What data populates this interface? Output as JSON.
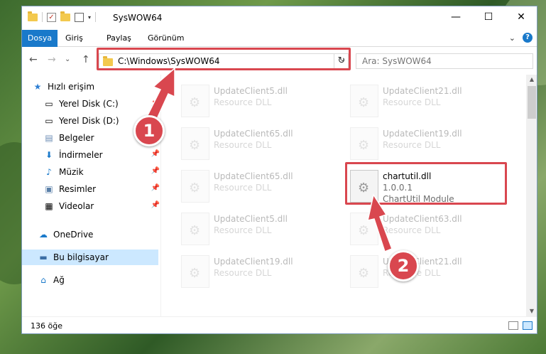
{
  "window": {
    "title": "SysWOW64",
    "controls": {
      "minimize": "—",
      "maximize": "☐",
      "close": "✕"
    }
  },
  "ribbon": {
    "tabs": [
      "Dosya",
      "Giriş",
      "Paylaş",
      "Görünüm"
    ],
    "help": "?"
  },
  "nav": {
    "back": "←",
    "forward": "→",
    "recent": "⌄",
    "up": "↑",
    "address": "C:\\Windows\\SysWOW64",
    "refresh": "↻",
    "search_placeholder": "Ara: SysWOW64"
  },
  "sidebar": {
    "items": [
      {
        "label": "Hızlı erişim",
        "icon": "star-icon"
      },
      {
        "label": "Yerel Disk (C:)",
        "icon": "drive-icon"
      },
      {
        "label": "Yerel Disk (D:)",
        "icon": "drive-icon"
      },
      {
        "label": "Belgeler",
        "icon": "documents-icon"
      },
      {
        "label": "İndirmeler",
        "icon": "download-icon"
      },
      {
        "label": "Müzik",
        "icon": "music-icon"
      },
      {
        "label": "Resimler",
        "icon": "pictures-icon"
      },
      {
        "label": "Videolar",
        "icon": "video-icon"
      },
      {
        "label": "OneDrive",
        "icon": "cloud-icon"
      },
      {
        "label": "Bu bilgisayar",
        "icon": "computer-icon"
      },
      {
        "label": "Ağ",
        "icon": "network-icon"
      }
    ]
  },
  "files": [
    {
      "name": "UpdateClient5.dll",
      "desc": "Resource DLL"
    },
    {
      "name": "UpdateClient21.dll",
      "desc": "Resource DLL"
    },
    {
      "name": "UpdateClient65.dll",
      "desc": "Resource DLL"
    },
    {
      "name": "UpdateClient19.dll",
      "desc": "Resource DLL"
    },
    {
      "name": "UpdateClient65.dll",
      "desc": "Resource DLL"
    },
    {
      "name": "chartutil.dll",
      "desc": "1.0.0.1",
      "desc2": "ChartUtil Module"
    },
    {
      "name": "UpdateClient5.dll",
      "desc": "Resource DLL"
    },
    {
      "name": "UpdateClient63.dll",
      "desc": "Resource DLL"
    },
    {
      "name": "UpdateClient19.dll",
      "desc": "Resource DLL"
    },
    {
      "name": "UpdateClient21.dll",
      "desc": "Resource DLL"
    }
  ],
  "status": {
    "count": "136 öğe"
  },
  "annotations": {
    "badge1": "1",
    "badge2": "2"
  },
  "colors": {
    "accent": "#1979ca",
    "highlight": "#d9474f"
  }
}
